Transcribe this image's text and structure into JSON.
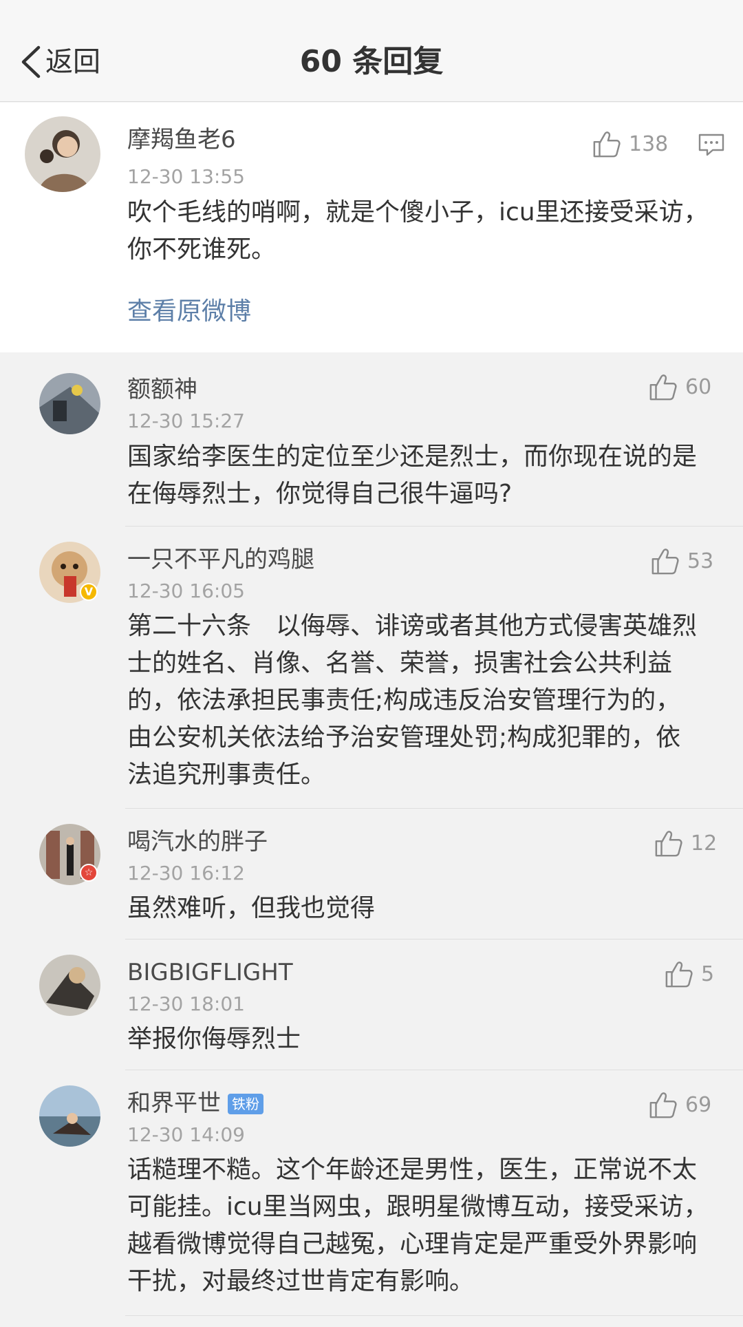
{
  "nav": {
    "back_label": "返回",
    "title": "60 条回复"
  },
  "main_comment": {
    "username": "摩羯鱼老6",
    "time": "12-30 13:55",
    "text": "吹个毛线的哨啊，就是个傻小子，icu里还接受采访，你不死谁死。",
    "likes": "138",
    "view_original": "查看原微博"
  },
  "replies": [
    {
      "username": "额额神",
      "time": "12-30 15:27",
      "likes": "60",
      "text": "国家给李医生的定位至少还是烈士，而你现在说的是在侮辱烈士，你觉得自己很牛逼吗?"
    },
    {
      "username": "一只不平凡的鸡腿",
      "time": "12-30 16:05",
      "likes": "53",
      "badge": "V",
      "text": "第二十六条　以侮辱、诽谤或者其他方式侵害英雄烈士的姓名、肖像、名誉、荣誉，损害社会公共利益的，依法承担民事责任;构成违反治安管理行为的，由公安机关依法给予治安管理处罚;构成犯罪的，依法追究刑事责任。"
    },
    {
      "username": "喝汽水的胖子",
      "time": "12-30 16:12",
      "likes": "12",
      "badge": "☆",
      "text": "虽然难听，但我也觉得"
    },
    {
      "username": "BIGBIGFLIGHT",
      "time": "12-30 18:01",
      "likes": "5",
      "text": "举报你侮辱烈士"
    },
    {
      "username": "和界平世",
      "time": "12-30 14:09",
      "likes": "69",
      "fan_badge": "铁粉",
      "text": "话糙理不糙。这个年龄还是男性，医生，正常说不太可能挂。icu里当网虫，跟明星微博互动，接受采访，越看微博觉得自己越冤，心理肯定是严重受外界影响干扰，对最终过世肯定有影响。"
    }
  ]
}
